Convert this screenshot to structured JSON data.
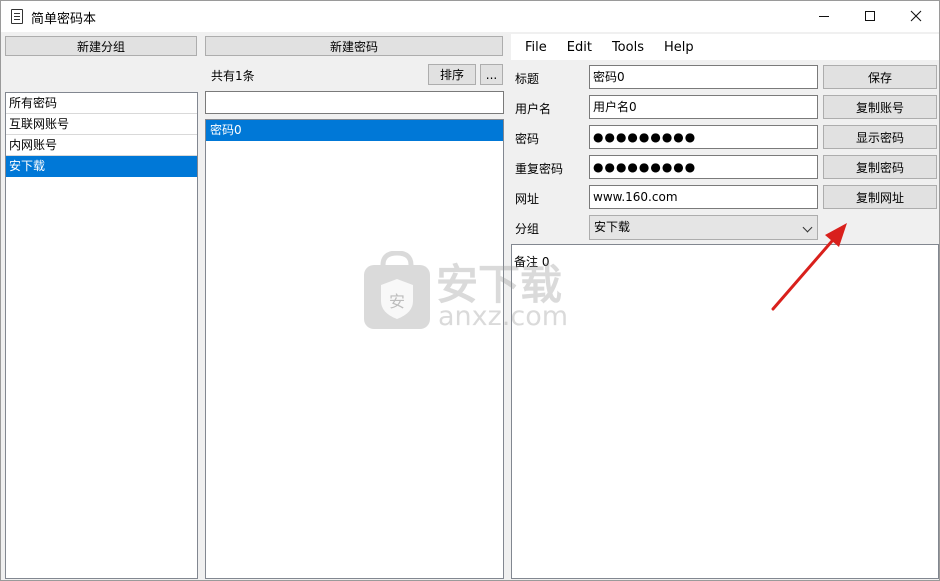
{
  "window": {
    "title": "简单密码本",
    "controls": {
      "minimize": "minimize",
      "maximize": "maximize",
      "close": "close"
    }
  },
  "left_panel": {
    "new_group_label": "新建分组",
    "groups": [
      {
        "label": "所有密码",
        "selected": false
      },
      {
        "label": "互联网账号",
        "selected": false
      },
      {
        "label": "内网账号",
        "selected": false
      },
      {
        "label": "安下载",
        "selected": true
      }
    ]
  },
  "middle_panel": {
    "new_password_label": "新建密码",
    "count_label": "共有1条",
    "sort_label": "排序",
    "more_label": "...",
    "filter_value": "",
    "entries": [
      {
        "label": "密码0",
        "selected": true
      }
    ]
  },
  "menu": {
    "items": [
      "File",
      "Edit",
      "Tools",
      "Help"
    ]
  },
  "form": {
    "title_label": "标题",
    "title_value": "密码0",
    "save_label": "保存",
    "username_label": "用户名",
    "username_value": "用户名0",
    "copy_username_label": "复制账号",
    "password_label": "密码",
    "password_value": "●●●●●●●●●",
    "show_password_label": "显示密码",
    "repeat_password_label": "重复密码",
    "repeat_password_value": "●●●●●●●●●",
    "copy_password_label": "复制密码",
    "url_label": "网址",
    "url_value": "www.160.com",
    "copy_url_label": "复制网址",
    "group_label": "分组",
    "group_value": "安下载"
  },
  "notes": {
    "text": "备注 0"
  },
  "watermark": {
    "title": "安下载",
    "subtitle": "anxz.com"
  },
  "colors": {
    "selection": "#0078d7",
    "annotation_arrow": "#d9201c"
  }
}
